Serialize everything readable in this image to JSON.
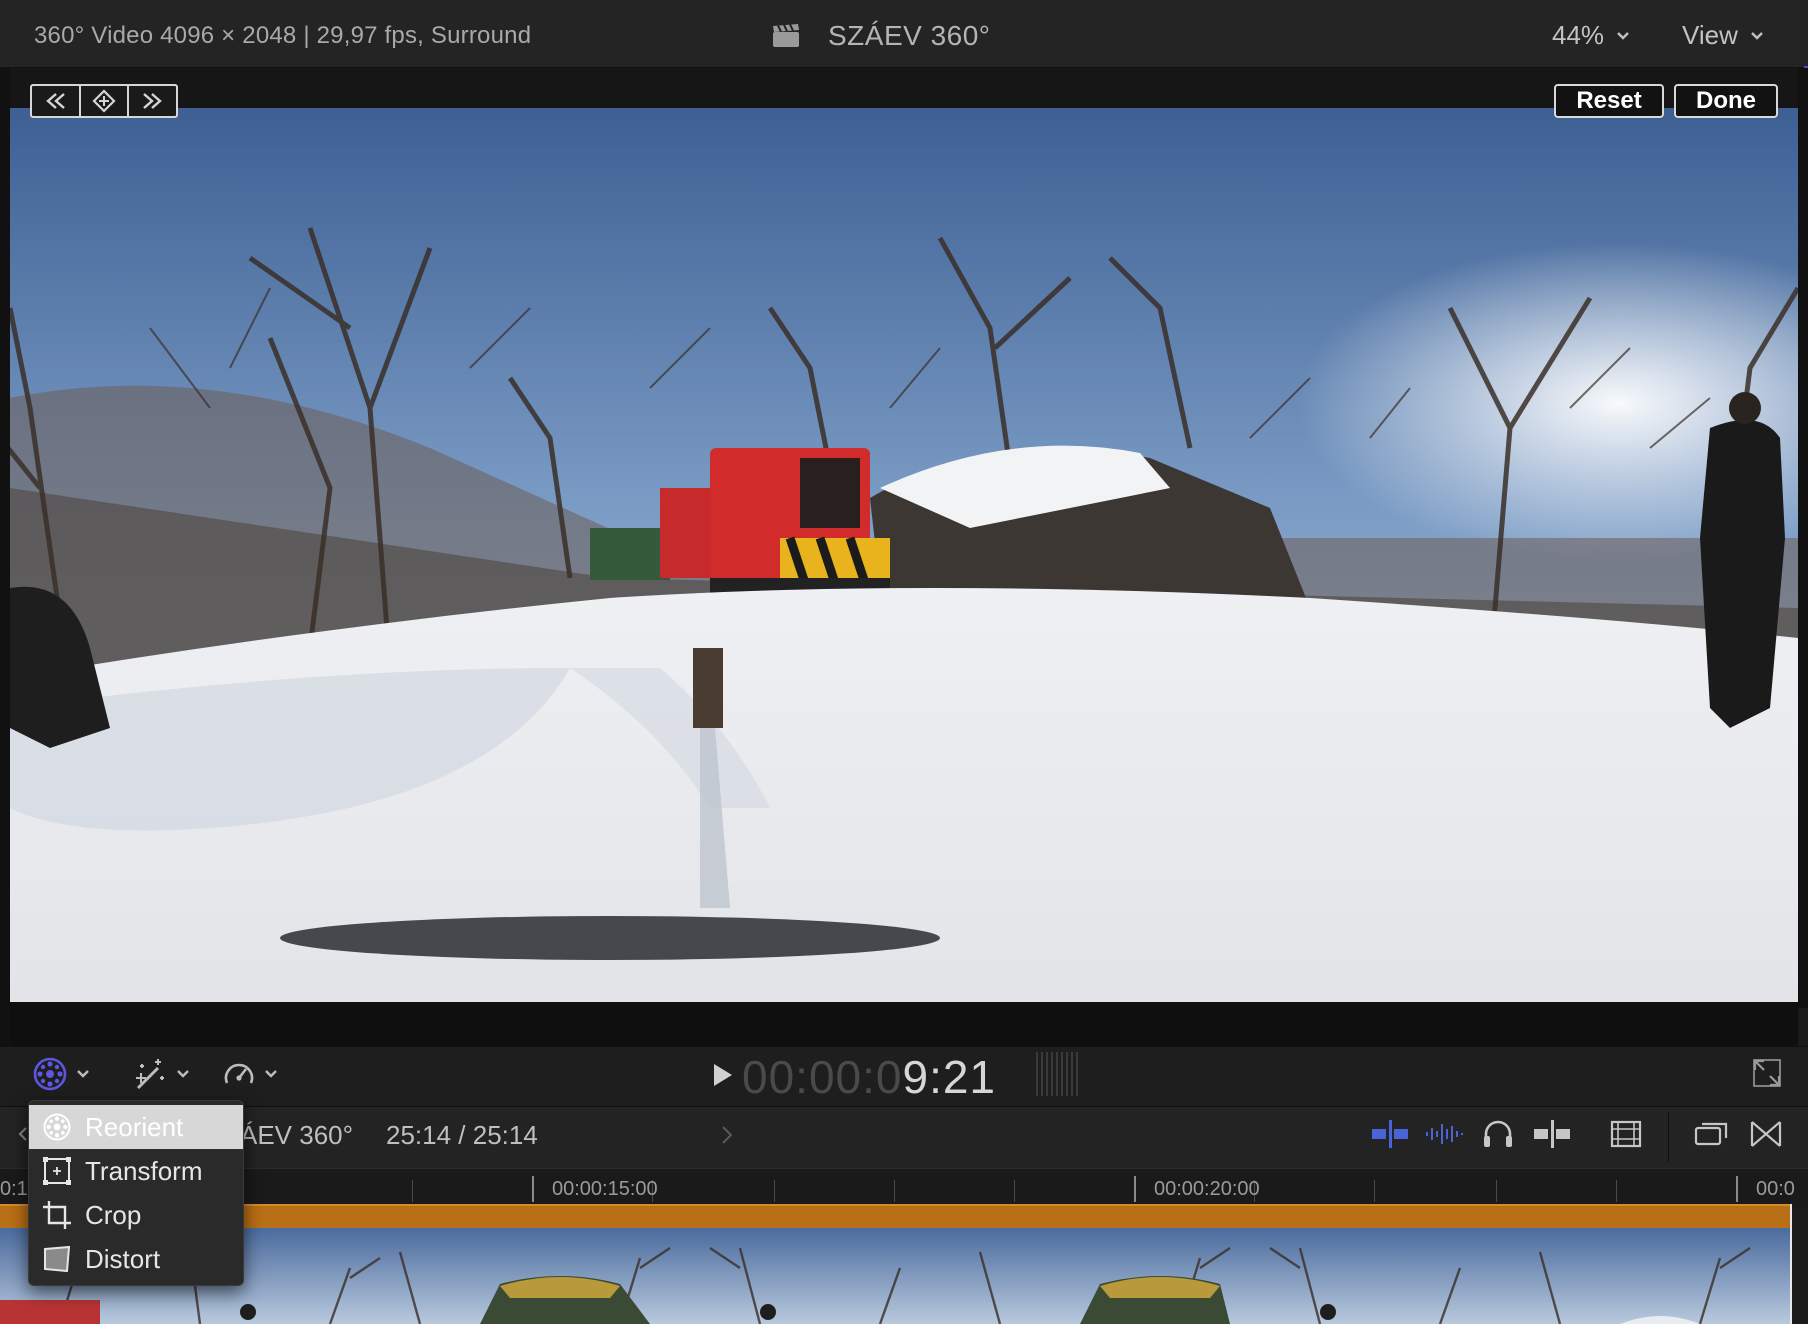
{
  "viewer_header": {
    "clip_info": "360° Video 4096 × 2048 | 29,97 fps, Surround",
    "project_title": "SZÁEV 360°",
    "zoom": "44%",
    "view_menu": "View"
  },
  "viewer_buttons": {
    "reset": "Reset",
    "done": "Done"
  },
  "controls": {
    "timecode_dim": "00:00:0",
    "timecode_lit": "9:21"
  },
  "timeline": {
    "project_name": "ÁEV 360°",
    "duration": "25:14 / 25:14",
    "ruler_labels": [
      "0:1",
      "00:00:15:00",
      "00:00:20:00",
      "00:0"
    ]
  },
  "transform_menu": {
    "items": [
      {
        "label": "Reorient",
        "icon": "reorient-icon",
        "selected": true
      },
      {
        "label": "Transform",
        "icon": "transform-icon",
        "selected": false
      },
      {
        "label": "Crop",
        "icon": "crop-icon",
        "selected": false
      },
      {
        "label": "Distort",
        "icon": "distort-icon",
        "selected": false
      }
    ]
  },
  "colors": {
    "accent_purple": "#5b57e0",
    "audio_blue": "#4a63d6",
    "clip_orange": "#b96f16"
  }
}
